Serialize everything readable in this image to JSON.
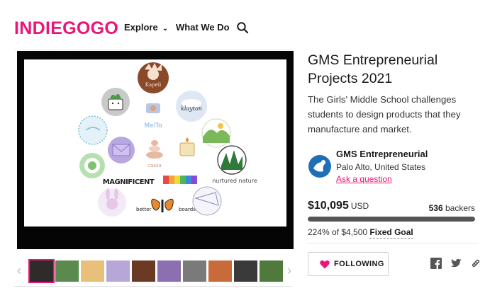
{
  "header": {
    "logo": "INDIEGOGO",
    "nav": {
      "explore": "Explore",
      "what_we_do": "What We Do"
    }
  },
  "project": {
    "title": "GMS Entrepreneurial Projects 2021",
    "blurb": "The Girls' Middle School challenges students to design products that they manufacture and market."
  },
  "owner": {
    "name": "GMS Entrepreneurial",
    "location": "Palo Alto, United States",
    "ask": "Ask a question"
  },
  "funding": {
    "amount": "$10,095",
    "currency": "USD",
    "backers_count": "536",
    "backers_label": "backers",
    "percent_text": "224% of $4,500",
    "goal_type": "Fixed Goal",
    "progress_fraction": 1.0
  },
  "actions": {
    "follow_label": "FOLLOWING"
  },
  "media": {
    "logo_labels": {
      "kapeli": "Kapeli",
      "klayton": "klayton",
      "melto": "MelTo",
      "magnificent": "MAGNIFICENT",
      "nurtured": "nurtured nature",
      "better": "better",
      "boards": "boards",
      "cassa": "cassa"
    },
    "thumbnails": [
      {
        "color": "#2e2b2a",
        "active": true
      },
      {
        "color": "#5b8a4e"
      },
      {
        "color": "#e8c07a"
      },
      {
        "color": "#b7a6d8"
      },
      {
        "color": "#6b3a24"
      },
      {
        "color": "#8c6fb0"
      },
      {
        "color": "#7a7a7a"
      },
      {
        "color": "#c86a3a"
      },
      {
        "color": "#3a3a3a"
      },
      {
        "color": "#4f7a3b"
      }
    ]
  },
  "colors": {
    "brand": "#eb1478",
    "progress": "#555555"
  }
}
